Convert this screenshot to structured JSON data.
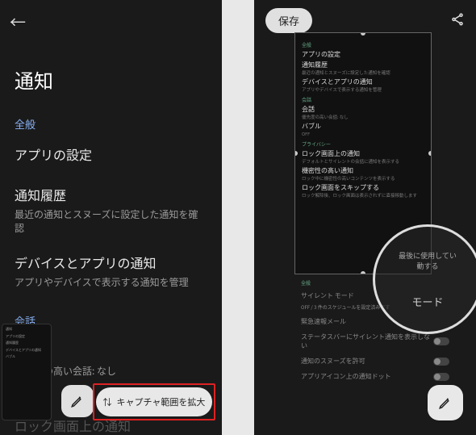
{
  "left": {
    "title": "通知",
    "sections": {
      "general_label": "全般",
      "app_settings": "アプリの設定",
      "history_title": "通知履歴",
      "history_sub": "最近の通知とスヌーズに設定した通知を確認",
      "device_title": "デバイスとアプリの通知",
      "device_sub": "アプリやデバイスで表示する通知を管理",
      "conv_label": "会話",
      "conv_title": "会話",
      "conv_sub": "優先度の高い会話: なし"
    },
    "thumb": {
      "t1": "通知",
      "t2": "アプリの設定",
      "t3": "通知履歴",
      "t4": "デバイスとアプリの通知",
      "t5": "バブル"
    },
    "capture_button": "キャプチャ範囲を拡大",
    "faded": "ロック画面上の通知"
  },
  "right": {
    "save": "保存",
    "longshot": {
      "g_label": "全般",
      "app": "アプリの設定",
      "hist_t": "通知履歴",
      "hist_s": "最近の通知とスヌーズに設定した通知を確認",
      "dev_t": "デバイスとアプリの通知",
      "dev_s": "アプリやデバイスで表示する通知を管理",
      "c_label": "会話",
      "conv_t": "会話",
      "conv_s": "優先度の高い会話: なし",
      "bub_t": "バブル",
      "bub_s": "OFF",
      "p_label": "プライバシー",
      "lock_t": "ロック画面上の通知",
      "lock_s": "デフォルトとサイレントの会話に通知を表示する",
      "sens_t": "機密性の高い通知",
      "sens_s": "ロック中に機密性の高いコンテンツを表示する",
      "skip_t": "ロック画面をスキップする",
      "skip_s": "ロック解除後、ロック画面は表示されずに直接移動します"
    },
    "under": {
      "g2": "全般",
      "silent_t": "サイレント モード",
      "silent_s": "OFF / 3 件のスケジュールを設定済みです",
      "emerg": "緊急速報メール",
      "status": "ステータスバーにサイレント通知を表示しない",
      "snooze": "通知のスヌーズを許可",
      "dot": "アプリアイコン上の通知ドット"
    },
    "lens": {
      "line1": "最後に使用してい",
      "line2": "動する",
      "mode": "モード"
    }
  }
}
